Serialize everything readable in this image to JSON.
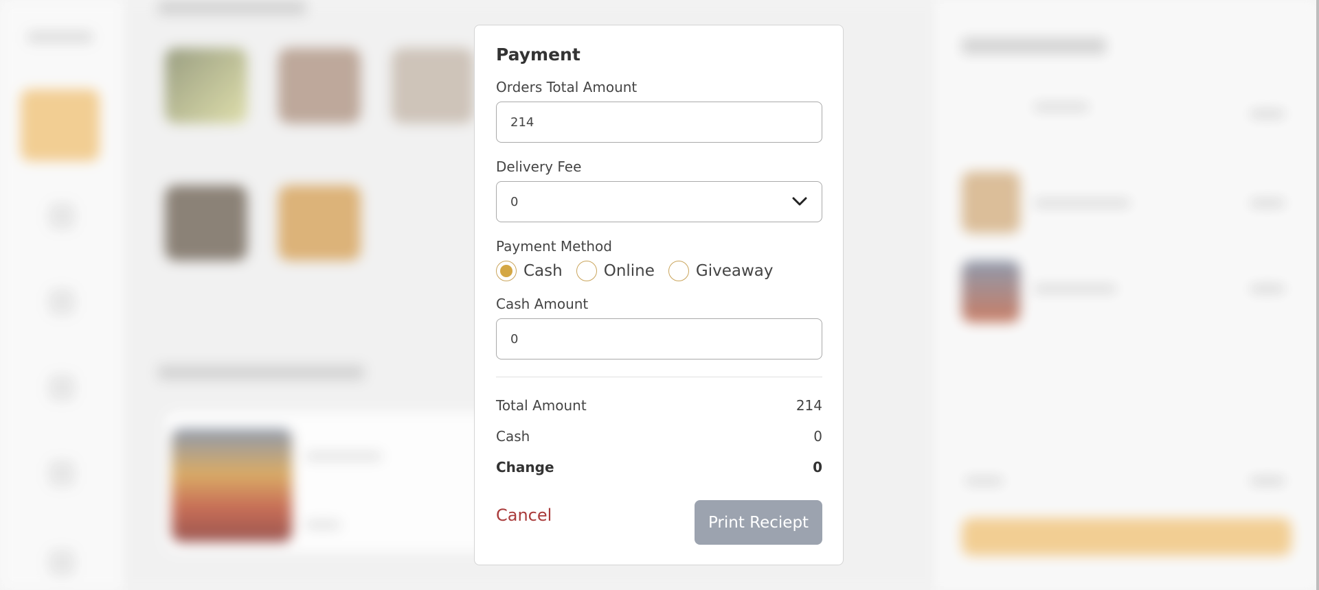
{
  "colors": {
    "accent": "#d4a744",
    "cancel": "#a93a3a",
    "print_button_bg": "#9ca3af"
  },
  "modal": {
    "title": "Payment",
    "orders_total": {
      "label": "Orders Total Amount",
      "value": "214"
    },
    "delivery_fee": {
      "label": "Delivery Fee",
      "selected": "0",
      "icon": "chevron-down-icon"
    },
    "payment_method": {
      "label": "Payment Method",
      "options": [
        {
          "label": "Cash",
          "selected": true
        },
        {
          "label": "Online",
          "selected": false
        },
        {
          "label": "Giveaway",
          "selected": false
        }
      ]
    },
    "cash_amount": {
      "label": "Cash Amount",
      "value": "0"
    },
    "summary": {
      "total": {
        "label": "Total Amount",
        "value": "214"
      },
      "cash": {
        "label": "Cash",
        "value": "0"
      },
      "change": {
        "label": "Change",
        "value": "0"
      }
    },
    "cancel_label": "Cancel",
    "print_label": "Print Reciept"
  }
}
